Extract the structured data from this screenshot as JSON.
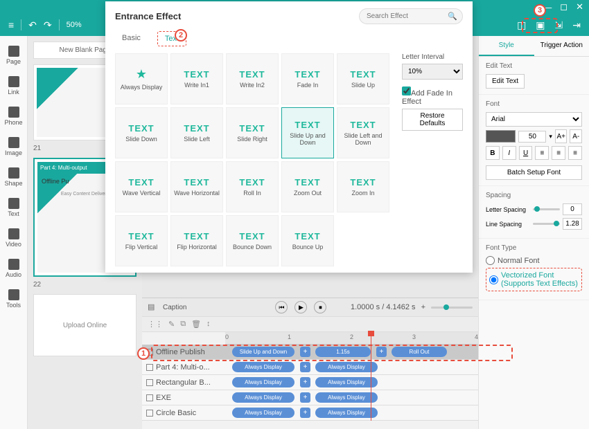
{
  "titlebar": {
    "min": "—",
    "max": "◻",
    "close": "✕"
  },
  "toolbar": {
    "menu": "≡",
    "undo": "↶",
    "redo": "↷",
    "zoom": "50%",
    "iconA": "◫",
    "save": "▣",
    "export": "⇲",
    "logout": "⇥"
  },
  "leftbar": {
    "items": [
      "Page",
      "Link",
      "Phone",
      "Image",
      "Shape",
      "Text",
      "Video",
      "Audio",
      "Tools"
    ]
  },
  "pages": {
    "newblank": "New Blank Page",
    "p21": "21",
    "p22": "22",
    "t1": "Part 4: Multi-output",
    "t1b": "Offline Pu",
    "t1c": "Easy Content Delivery",
    "t2": "Upload Online"
  },
  "modal": {
    "title": "Entrance Effect",
    "search_ph": "Search Effect",
    "tabs": {
      "basic": "Basic",
      "text": "Text"
    },
    "effects": [
      "Always Display",
      "Write In1",
      "Write In2",
      "Fade In",
      "Slide Up",
      "Slide Down",
      "Slide Left",
      "Slide Right",
      "Slide Up and Down",
      "Slide Left and Down",
      "Wave Vertical",
      "Wave Horizontal",
      "Roll In",
      "Zoom Out",
      "Zoom In",
      "Flip Vertical",
      "Flip Horizontal",
      "Bounce Down",
      "Bounce Up"
    ],
    "right": {
      "interval_lb": "Letter Interval",
      "interval_val": "10%",
      "fadein": "Add Fade In Effect",
      "restore": "Restore Defaults"
    }
  },
  "right": {
    "tabs": {
      "style": "Style",
      "trigger": "Trigger Action"
    },
    "edit_h": "Edit Text",
    "edit_btn": "Edit Text",
    "font_h": "Font",
    "font_family": "Arial",
    "font_size": "50",
    "a_plus": "A+",
    "a_minus": "A-",
    "b": "B",
    "i": "I",
    "u": "U",
    "batch": "Batch Setup Font",
    "spacing_h": "Spacing",
    "letter_sp": "Letter Spacing",
    "letter_v": "0",
    "line_sp": "Line Spacing",
    "line_v": "1.28",
    "ftype_h": "Font Type",
    "normal": "Normal Font",
    "vector": "Vectorized Font (Supports Text Effects)"
  },
  "timeline": {
    "caption": "Caption",
    "time": "1.0000 s / 4.1462 s",
    "plus": "+",
    "ticks": [
      "0",
      "1",
      "2",
      "3",
      "4"
    ],
    "tracks": [
      {
        "name": "Offline Publish",
        "hl": true,
        "clips": [
          {
            "l": 10,
            "w": 90,
            "t": "Slide Up and Down"
          },
          {
            "l": 130,
            "w": 80,
            "t": "1.15s"
          },
          {
            "l": 240,
            "w": 80,
            "t": "Roll Out"
          }
        ],
        "plus": [
          108,
          218
        ]
      },
      {
        "name": "Part 4: Multi-o...",
        "clips": [
          {
            "l": 10,
            "w": 90,
            "t": "Always Display"
          },
          {
            "l": 130,
            "w": 90,
            "t": "Always Display"
          }
        ],
        "plus": [
          108
        ]
      },
      {
        "name": "Rectangular B...",
        "clips": [
          {
            "l": 10,
            "w": 90,
            "t": "Always Display"
          },
          {
            "l": 130,
            "w": 90,
            "t": "Always Display"
          }
        ],
        "plus": [
          108
        ]
      },
      {
        "name": "EXE",
        "clips": [
          {
            "l": 10,
            "w": 90,
            "t": "Always Display"
          },
          {
            "l": 130,
            "w": 90,
            "t": "Always Display"
          }
        ],
        "plus": [
          108
        ]
      },
      {
        "name": "Circle Basic",
        "clips": [
          {
            "l": 10,
            "w": 90,
            "t": "Always Display"
          },
          {
            "l": 130,
            "w": 90,
            "t": "Always Display"
          }
        ],
        "plus": [
          108
        ]
      }
    ]
  },
  "callouts": {
    "c1": "1",
    "c2": "2",
    "c3": "3"
  }
}
